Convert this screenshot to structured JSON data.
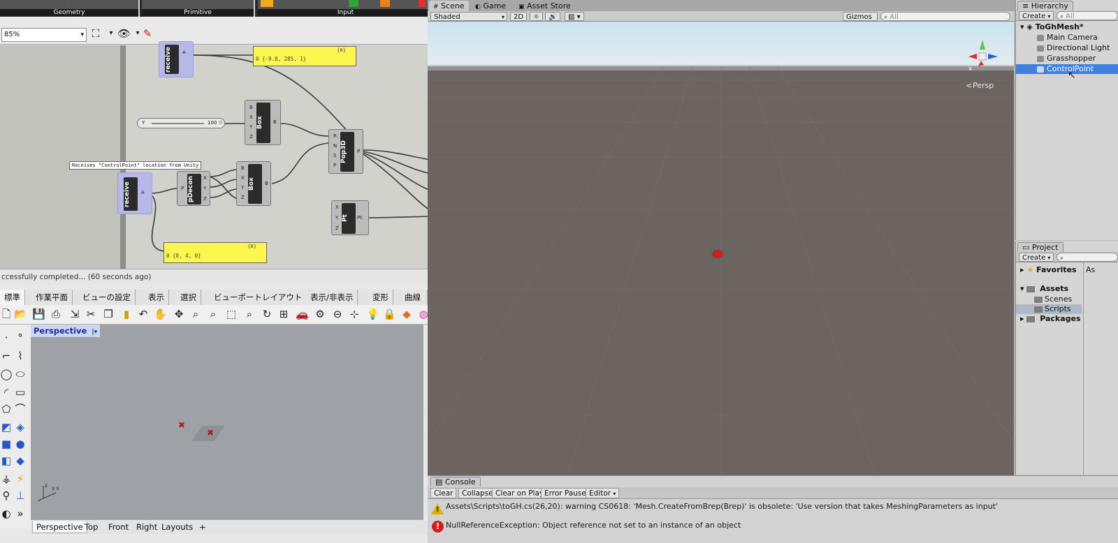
{
  "grasshopper": {
    "ribbon_groups": [
      "Geometry",
      "Primitive",
      "Input"
    ],
    "zoom": "85%",
    "zoom_arrow": "▾",
    "status": "ccessfully completed... (60 seconds ago)",
    "components": {
      "receive_top": "receive",
      "receive_bottom": "receive",
      "box1": "Box",
      "box2": "Box",
      "pdecon": "pDecon",
      "pop3d": "Pop3D",
      "pt": "Pt"
    },
    "tooltip": "Receives \"ControlPoint\" location from Unity",
    "panel_top": "0 {-9.8, 285, 1}",
    "panel_top_hdr": "{0}",
    "panel_bottom": "0 {0, 4, 0}",
    "panel_bottom_hdr": "{0}",
    "slider_label": "Y",
    "slider_value": "100"
  },
  "rhino": {
    "tabs": [
      "標準",
      "作業平面",
      "ビューの設定",
      "表示",
      "選択",
      "ビューポートレイアウト",
      "表示/非表示",
      "変形",
      "曲線ツ"
    ],
    "viewport_title": "Perspective",
    "viewport_tabs": [
      "Perspective",
      "Top",
      "Front",
      "Right",
      "Layouts"
    ],
    "add_tab": "+"
  },
  "unity": {
    "scene_tabs": [
      "Scene",
      "Game",
      "Asset Store"
    ],
    "shading_mode": "Shaded",
    "mode_2d": "2D",
    "gizmos": "Gizmos",
    "search_all": "All",
    "persp_label": "Persp",
    "hierarchy": {
      "tab": "Hierarchy",
      "create": "Create",
      "search": "All",
      "scene": "ToGhMesh*",
      "items": [
        "Main Camera",
        "Directional Light",
        "Grasshopper",
        "ControlPoint"
      ]
    },
    "project": {
      "tab": "Project",
      "create": "Create",
      "favorites": "Favorites",
      "assets": "Assets",
      "folders": [
        "Scenes",
        "Scripts"
      ],
      "packages": "Packages",
      "col2": "As"
    },
    "console": {
      "tab": "Console",
      "buttons": [
        "Clear",
        "Collapse",
        "Clear on Play",
        "Error Pause",
        "Editor"
      ],
      "warning": "Assets\\Scripts\\toGH.cs(26,20): warning CS0618: 'Mesh.CreateFromBrep(Brep)' is obsolete: 'Use version that takes MeshingParameters as input'",
      "error": "NullReferenceException: Object reference not set to an instance of an object"
    }
  }
}
